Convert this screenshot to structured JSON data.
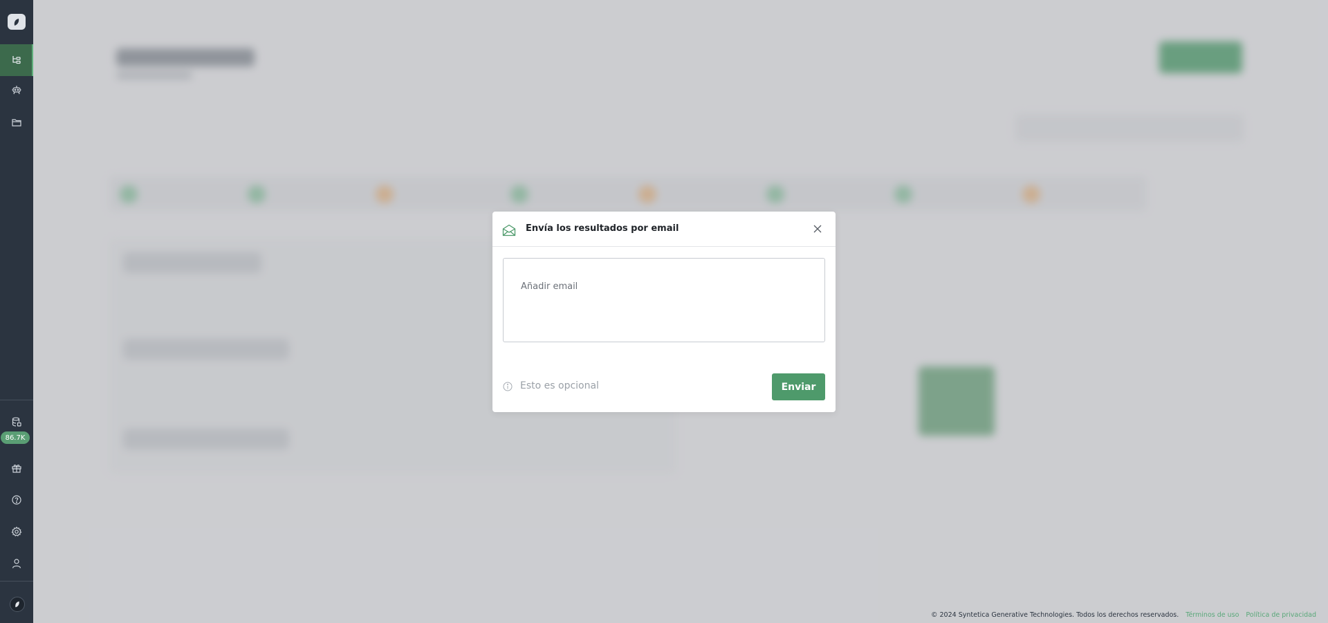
{
  "sidebar": {
    "credits_badge": "86.7K",
    "items": [
      {
        "name": "workflow-icon"
      },
      {
        "name": "robot-icon"
      },
      {
        "name": "folder-icon"
      },
      {
        "name": "database-icon"
      },
      {
        "name": "gift-icon"
      },
      {
        "name": "help-icon"
      },
      {
        "name": "gear-icon"
      },
      {
        "name": "user-icon"
      }
    ]
  },
  "modal": {
    "title": "Envía los resultados por email",
    "email_placeholder": "Añadir email",
    "optional_note": "Esto es opcional",
    "send_label": "Enviar"
  },
  "footer": {
    "copyright": "© 2024 Syntetica Generative Technologies. Todos los derechos reservados.",
    "terms_link": "Términos de uso",
    "privacy_link": "Política de privacidad"
  },
  "colors": {
    "sidebar_bg": "#2b3440",
    "accent": "#4e9a6b",
    "sidebar_active": "#3c6a4c"
  }
}
